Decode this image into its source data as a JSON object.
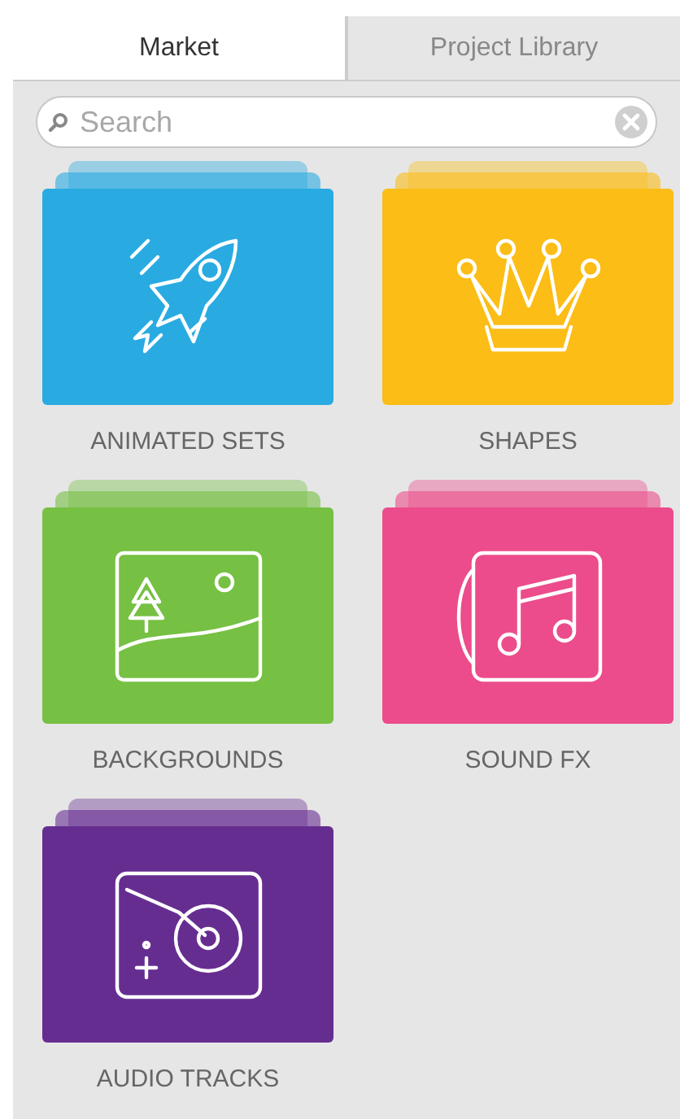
{
  "tabs": [
    {
      "label": "Market",
      "selected": true
    },
    {
      "label": "Project Library",
      "selected": false
    }
  ],
  "search": {
    "placeholder": "Search"
  },
  "categories": [
    {
      "label": "ANIMATED SETS",
      "color": "#29abe2",
      "kind": "rocket"
    },
    {
      "label": "SHAPES",
      "color": "#fbbd16",
      "kind": "crown"
    },
    {
      "label": "BACKGROUNDS",
      "color": "#76c043",
      "kind": "landscape"
    },
    {
      "label": "SOUND FX",
      "color": "#ec4c8b",
      "kind": "music"
    },
    {
      "label": "AUDIO TRACKS",
      "color": "#662d91",
      "kind": "turntable"
    }
  ]
}
